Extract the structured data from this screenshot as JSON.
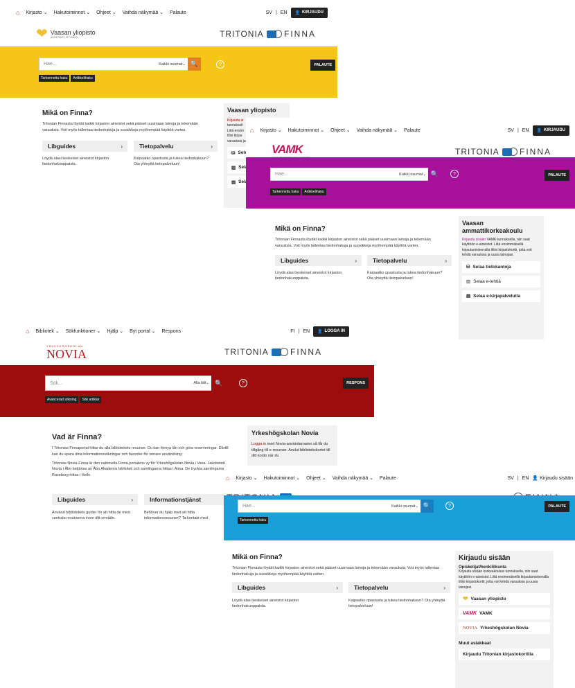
{
  "s1": {
    "nav": [
      "Kirjasto ⌄",
      "Hakutoiminnot ⌄",
      "Ohjeet ⌄",
      "Vaihda näkymää ⌄",
      "Palaute"
    ],
    "lang": [
      "SV",
      "|",
      "EN"
    ],
    "login": "KIRJAUDU",
    "uni_name": "Vaasan yliopisto",
    "uni_sub": "UNIVERSITY OF VAASA",
    "tritonia": "TRITONIA",
    "finna": "FINNA",
    "search_ph": "Hae...",
    "search_sel": "Kaikki osumat⌄",
    "palaute": "PALAUTE",
    "links": [
      "Tarkennettu haku",
      "Artikkelihaku"
    ],
    "heading": "Mikä on Finna?",
    "intro": "Tritonian Finnasta löydät kaikki kirjaston aineistot sekä pääset uusimaan lainoja ja tekemään varauksia. Voit myös tallentaa tiedonhakuja ja suosikkeja myöhempää käyttöä varten.",
    "card1": "Libguides",
    "card1_desc": "Löydä alasi keskeiset aineistot kirjaston tiedonhakuoppaista.",
    "card2": "Tietopalvelu",
    "card2_desc": "Kaipaatko opastusta ja tukea tiedonhakuun? Ota yhteyttä tietopalveluun!",
    "side_title": "Vaasan yliopisto",
    "side_text1": "Kirjaudu si",
    "side_text2": "tunnuksell",
    "side_text3": "Liitä ensim",
    "side_text4": "tilisi kirjas",
    "side_text5": "varauksia ja",
    "side_b": [
      "Sele",
      "Sela",
      "Sela"
    ],
    "colors": {
      "band": "#f5c518",
      "btn": "#e67e22"
    }
  },
  "s2": {
    "nav": [
      "Kirjasto ⌄",
      "Hakutoiminnot ⌄",
      "Ohjeet ⌄",
      "Vaihda näkymää ⌄",
      "Palaute"
    ],
    "lang": [
      "SV",
      "|",
      "EN"
    ],
    "login": "KIRJAUDU",
    "logo": "VAMK",
    "logo_sub": "VAASAN AMMATTIKORKEAKOULU UNIVERSITY OF APPLIED SCIENCES",
    "tritonia": "TRITONIA",
    "finna": "FINNA",
    "search_ph": "Hae...",
    "search_sel": "Kaikki osumat⌄",
    "palaute": "PALAUTE",
    "links": [
      "Tarkennettu haku",
      "Artikkelihaku"
    ],
    "heading": "Mikä on Finna?",
    "intro": "Tritonian Finnasta löydät kaikki kirjaston aineistot sekä pääset uusimaan lainoja ja tekemään varauksia. Voit myös tallentaa tiedonhakuja ja suosikkeja myöhempää käyttöä varten.",
    "card1": "Libguides",
    "card1_desc": "Löydä alasi keskeiset aineistot kirjaston tiedonhakuoppaista.",
    "card2": "Tietopalvelu",
    "card2_desc": "Kaipaatko opastusta ja tukea tiedonhakuun? Ota yhteyttä tietopalveluun!",
    "side_title": "Vaasan ammattikorkeakoulu",
    "side_link": "Kirjaudu sisään",
    "side_text": " VAMK-tunnuksella, niin saat käyttöön e-aineistot. Liitä ensimmäisellä kirjautumiskerralla tiliisi kirjastokortti, jotta voit tehdä varauksia ja uusia lainojasi.",
    "side_b": [
      "Selaa tietokantoja",
      "Selaa e-lehtiä",
      "Selaa e-kirjapalveluita"
    ],
    "colors": {
      "band": "#a6109b",
      "btn": "#a6109b"
    }
  },
  "s3": {
    "nav": [
      "Bibliotek ⌄",
      "Sökfunktioner ⌄",
      "Hjälp ⌄",
      "Byt portal ⌄",
      "Respons"
    ],
    "lang": [
      "FI",
      "|",
      "EN"
    ],
    "login": "LOGGA IN",
    "logo_top": "YRKESHÖGSKOLAN",
    "logo": "NOVIA",
    "tritonia": "TRITONIA",
    "finna": "FINNA",
    "search_ph": "Sök...",
    "search_sel": "Alla fält⌄",
    "palaute": "RESPONS",
    "links": [
      "Avancerad sökning",
      "Sök artiklar"
    ],
    "heading": "Vad är Finna?",
    "intro1": "I Tritonias Finnaportal hittar du alla bibliotekets resurser. Du kan förnya lån och göra reserveringar. Därtill kan du spara dina informationssökningar och favoriter för senare användning.",
    "intro2": "Tritonias Novia-Finna är den nationella Finna-portalens vy för Yrkeshögskolan Novia i Vasa. Jakobstad. Novia i Åbo betjänas av Åbo Akademis bibliotek och samlingarna hittas i Alma. De tryckta samlingarna i Raseborg hittas i Helle.",
    "card1": "Libguides",
    "card1_desc": "Använd bibliotekets guider för att hitta de mest centrala resurserna inom ditt område.",
    "card2": "Informationstjänst",
    "card2_desc": "Behöver du hjälp med att hitta informationsresurser? Ta kontakt med informationstjänsten!",
    "side_title": "Yrkeshögskolan Novia",
    "side_link": "Logga in",
    "side_text": " med Novia-användarnamn så får du tillgång till e-resurser. Anslut bibliotekskortet till ditt konto när du",
    "colors": {
      "band": "#9e0d0d",
      "btn": "#9e0d0d"
    }
  },
  "s4": {
    "nav": [
      "Kirjasto ⌄",
      "Hakutoiminnot ⌄",
      "Ohjeet ⌄",
      "Vaihda näkymää ⌄",
      "Palaute"
    ],
    "lang": [
      "SV",
      "|",
      "EN"
    ],
    "login": "Kirjaudu sisään",
    "tritonia": "TRITONIA",
    "finna": "FINNA",
    "search_ph": "Hae...",
    "search_sel": "Kaikki osumat⌄",
    "palaute": "PALAUTE",
    "links": [
      "Tarkennettu haku"
    ],
    "heading": "Mikä on Finna?",
    "intro": "Tritonian Finnasta löydät kaikki kirjaston aineistot sekä pääset uusimaan lainoja ja tekemään varauksia. Voit myös tallentaa tiedonhakuja ja suosikkeja myöhempää käyttöä varten.",
    "card1": "Libguides",
    "card1_desc": "Löydä alasi keskeiset aineistot kirjaston tiedonhakuoppaista.",
    "card2": "Tietopalvelu",
    "card2_desc": "Kaipaatko opastusta ja tukea tiedonhakuun? Ota yhteyttä tietopalveluun!",
    "side_title": "Kirjaudu sisään",
    "side_sub": "Opiskelijat/henkilökunta",
    "side_text": "Kirjaudu sisään korkeakoulusi tunnuksella, niin saat käyttöön e-aineistot. Liitä ensimmäisellä kirjautumiskerralla tiliisi kirjastokortti, jotta voit tehdä varauksia ja uusia lainojasi.",
    "side_b": [
      "Vaasan yliopisto",
      "VAMK",
      "Yrkeshögskolan Novia"
    ],
    "vamk_logo": "VAMK",
    "novia_logo": "NOVIA",
    "side_sub2": "Muut asiakkaat",
    "side_b2": "Kirjaudu Tritonian kirjastokortilla",
    "colors": {
      "band": "#1a9fd8",
      "btn": "#1a7fc2"
    }
  }
}
